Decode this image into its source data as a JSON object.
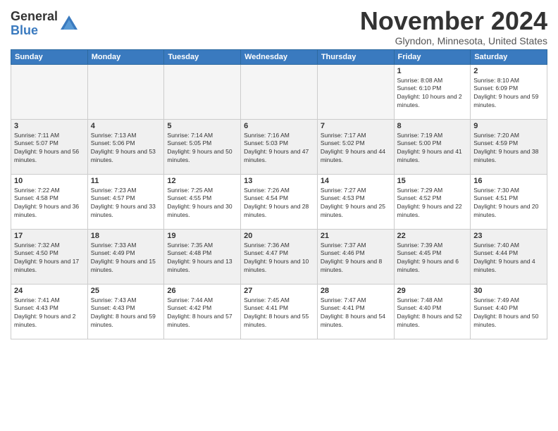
{
  "header": {
    "logo_line1": "General",
    "logo_line2": "Blue",
    "month_title": "November 2024",
    "location": "Glyndon, Minnesota, United States"
  },
  "weekdays": [
    "Sunday",
    "Monday",
    "Tuesday",
    "Wednesday",
    "Thursday",
    "Friday",
    "Saturday"
  ],
  "weeks": [
    [
      {
        "day": "",
        "empty": true
      },
      {
        "day": "",
        "empty": true
      },
      {
        "day": "",
        "empty": true
      },
      {
        "day": "",
        "empty": true
      },
      {
        "day": "",
        "empty": true
      },
      {
        "day": "1",
        "info": "Sunrise: 8:08 AM\nSunset: 6:10 PM\nDaylight: 10 hours and 2 minutes."
      },
      {
        "day": "2",
        "info": "Sunrise: 8:10 AM\nSunset: 6:09 PM\nDaylight: 9 hours and 59 minutes."
      }
    ],
    [
      {
        "day": "3",
        "info": "Sunrise: 7:11 AM\nSunset: 5:07 PM\nDaylight: 9 hours and 56 minutes."
      },
      {
        "day": "4",
        "info": "Sunrise: 7:13 AM\nSunset: 5:06 PM\nDaylight: 9 hours and 53 minutes."
      },
      {
        "day": "5",
        "info": "Sunrise: 7:14 AM\nSunset: 5:05 PM\nDaylight: 9 hours and 50 minutes."
      },
      {
        "day": "6",
        "info": "Sunrise: 7:16 AM\nSunset: 5:03 PM\nDaylight: 9 hours and 47 minutes."
      },
      {
        "day": "7",
        "info": "Sunrise: 7:17 AM\nSunset: 5:02 PM\nDaylight: 9 hours and 44 minutes."
      },
      {
        "day": "8",
        "info": "Sunrise: 7:19 AM\nSunset: 5:00 PM\nDaylight: 9 hours and 41 minutes."
      },
      {
        "day": "9",
        "info": "Sunrise: 7:20 AM\nSunset: 4:59 PM\nDaylight: 9 hours and 38 minutes."
      }
    ],
    [
      {
        "day": "10",
        "info": "Sunrise: 7:22 AM\nSunset: 4:58 PM\nDaylight: 9 hours and 36 minutes."
      },
      {
        "day": "11",
        "info": "Sunrise: 7:23 AM\nSunset: 4:57 PM\nDaylight: 9 hours and 33 minutes."
      },
      {
        "day": "12",
        "info": "Sunrise: 7:25 AM\nSunset: 4:55 PM\nDaylight: 9 hours and 30 minutes."
      },
      {
        "day": "13",
        "info": "Sunrise: 7:26 AM\nSunset: 4:54 PM\nDaylight: 9 hours and 28 minutes."
      },
      {
        "day": "14",
        "info": "Sunrise: 7:27 AM\nSunset: 4:53 PM\nDaylight: 9 hours and 25 minutes."
      },
      {
        "day": "15",
        "info": "Sunrise: 7:29 AM\nSunset: 4:52 PM\nDaylight: 9 hours and 22 minutes."
      },
      {
        "day": "16",
        "info": "Sunrise: 7:30 AM\nSunset: 4:51 PM\nDaylight: 9 hours and 20 minutes."
      }
    ],
    [
      {
        "day": "17",
        "info": "Sunrise: 7:32 AM\nSunset: 4:50 PM\nDaylight: 9 hours and 17 minutes."
      },
      {
        "day": "18",
        "info": "Sunrise: 7:33 AM\nSunset: 4:49 PM\nDaylight: 9 hours and 15 minutes."
      },
      {
        "day": "19",
        "info": "Sunrise: 7:35 AM\nSunset: 4:48 PM\nDaylight: 9 hours and 13 minutes."
      },
      {
        "day": "20",
        "info": "Sunrise: 7:36 AM\nSunset: 4:47 PM\nDaylight: 9 hours and 10 minutes."
      },
      {
        "day": "21",
        "info": "Sunrise: 7:37 AM\nSunset: 4:46 PM\nDaylight: 9 hours and 8 minutes."
      },
      {
        "day": "22",
        "info": "Sunrise: 7:39 AM\nSunset: 4:45 PM\nDaylight: 9 hours and 6 minutes."
      },
      {
        "day": "23",
        "info": "Sunrise: 7:40 AM\nSunset: 4:44 PM\nDaylight: 9 hours and 4 minutes."
      }
    ],
    [
      {
        "day": "24",
        "info": "Sunrise: 7:41 AM\nSunset: 4:43 PM\nDaylight: 9 hours and 2 minutes."
      },
      {
        "day": "25",
        "info": "Sunrise: 7:43 AM\nSunset: 4:43 PM\nDaylight: 8 hours and 59 minutes."
      },
      {
        "day": "26",
        "info": "Sunrise: 7:44 AM\nSunset: 4:42 PM\nDaylight: 8 hours and 57 minutes."
      },
      {
        "day": "27",
        "info": "Sunrise: 7:45 AM\nSunset: 4:41 PM\nDaylight: 8 hours and 55 minutes."
      },
      {
        "day": "28",
        "info": "Sunrise: 7:47 AM\nSunset: 4:41 PM\nDaylight: 8 hours and 54 minutes."
      },
      {
        "day": "29",
        "info": "Sunrise: 7:48 AM\nSunset: 4:40 PM\nDaylight: 8 hours and 52 minutes."
      },
      {
        "day": "30",
        "info": "Sunrise: 7:49 AM\nSunset: 4:40 PM\nDaylight: 8 hours and 50 minutes."
      }
    ]
  ]
}
